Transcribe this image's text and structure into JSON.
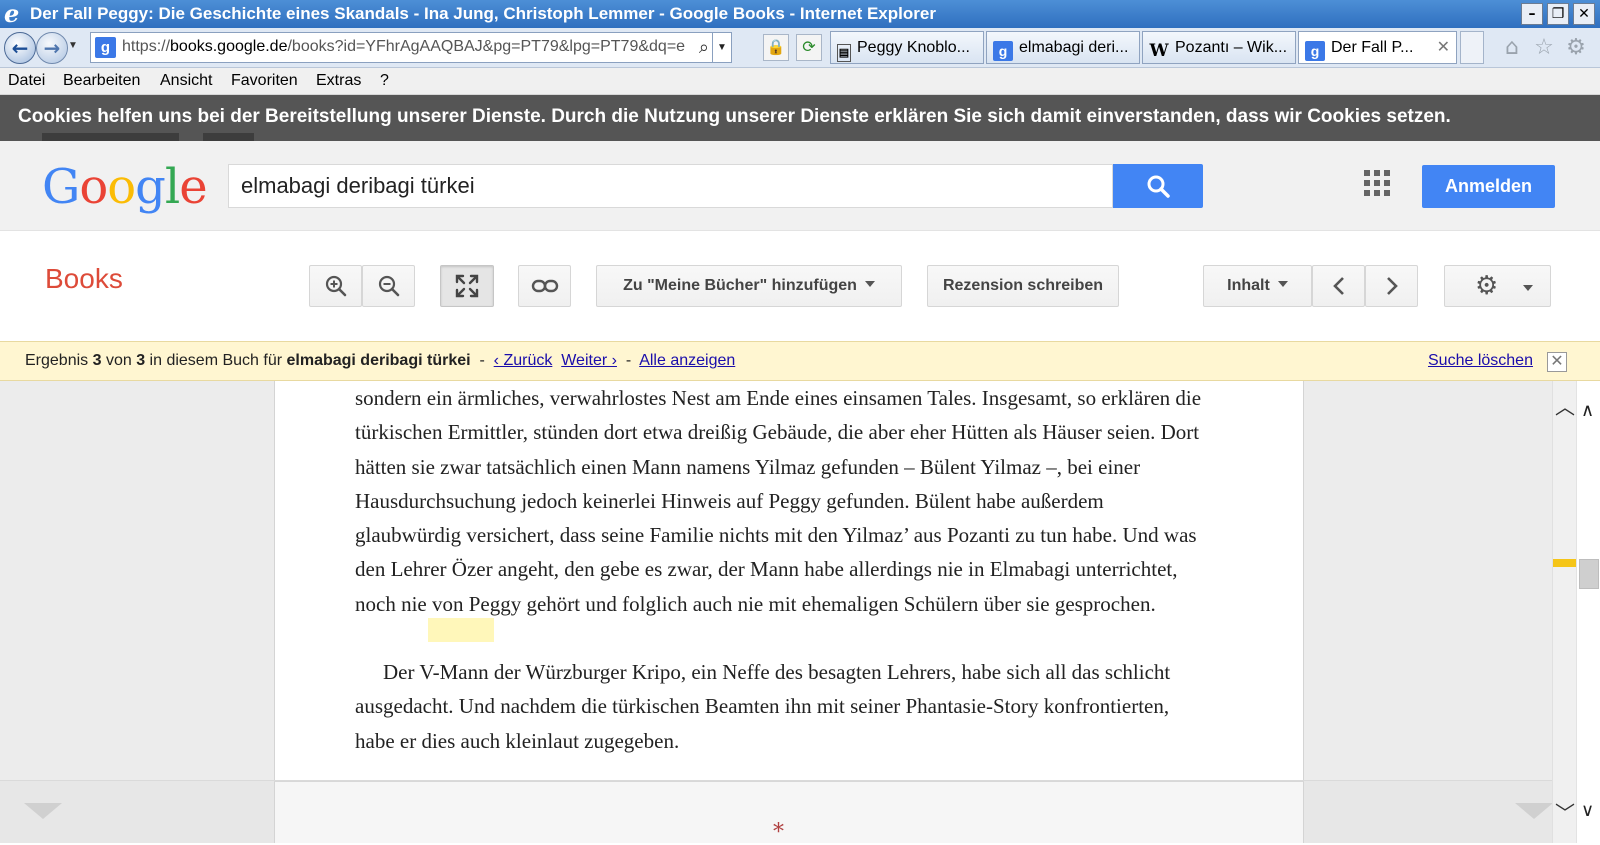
{
  "window": {
    "title": "Der Fall Peggy: Die Geschichte eines Skandals - Ina Jung, Christoph Lemmer - Google Books - Internet Explorer",
    "minimize": "–",
    "restore": "❐",
    "close": "✕"
  },
  "address_bar": {
    "url_prefix": "https://",
    "url_host": "books.google.de",
    "url_rest": "/books?id=YFhrAgAAQBAJ&pg=PT79&lpg=PT79&dq=e"
  },
  "tabs": [
    {
      "label": "Peggy Knoblo...",
      "icon": "document-icon",
      "active": false
    },
    {
      "label": "elmabagi deri...",
      "icon": "google-icon",
      "active": false
    },
    {
      "label": "Pozantı – Wik...",
      "icon": "wikipedia-icon",
      "active": false
    },
    {
      "label": "Der Fall P...",
      "icon": "google-icon",
      "active": true
    }
  ],
  "menu": [
    "Datei",
    "Bearbeiten",
    "Ansicht",
    "Favoriten",
    "Extras",
    "?"
  ],
  "cookie_banner": {
    "text": "Cookies helfen uns bei der Bereitstellung unserer Dienste. Durch die Nutzung unserer Dienste erklären Sie sich damit einverstanden, dass wir Cookies setzen."
  },
  "google_header": {
    "logo": [
      "G",
      "o",
      "o",
      "g",
      "l",
      "e"
    ],
    "search_value": "elmabagi deribagi türkei",
    "signin_label": "Anmelden"
  },
  "books_toolbar": {
    "brand": "Books",
    "add_to_library": "Zu \"Meine Bücher\" hinzufügen",
    "write_review": "Rezension schreiben",
    "contents": "Inhalt"
  },
  "result_bar": {
    "prefix": "Ergebnis ",
    "current": "3",
    "of": " von ",
    "total": "3",
    "middle": " in diesem Buch für ",
    "query": "elmabagi deribagi türkei",
    "sep1": "  -  ",
    "back": "‹ Zurück",
    "next": "Weiter ›",
    "sep2": "  -  ",
    "show_all": "Alle anzeigen",
    "clear": "Suche löschen"
  },
  "book_text": {
    "p1": "sondern ein ärmliches, verwahrlostes Nest am Ende eines einsamen Tales. Insgesamt, so erklären die türkischen Ermittler, stünden dort etwa dreißig Gebäude, die aber eher Hütten als Häuser seien. Dort hätten sie zwar tatsächlich einen Mann namens Yilmaz gefunden – Bülent Yilmaz –, bei einer Hausdurchsuchung jedoch keinerlei Hinweis auf Peggy gefunden. Bülent habe außerdem glaubwürdig versichert, dass seine Familie nichts mit den Yilmaz’ aus Pozanti zu tun habe. Und was den Lehrer Özer angeht, den gebe es zwar, der Mann habe allerdings nie in Elmabagi unterrichtet, noch nie von Peggy gehört und folglich auch nie mit ehemaligen Schülern über sie gesprochen.",
    "p2": "Der V-Mann der Würzburger Kripo, ein Neffe des besagten Lehrers, habe sich all das schlicht ausgedacht. Und nachdem die türkischen Beamten ihn mit seiner Phantasie-Story konfrontierten, habe er dies auch kleinlaut zugegeben.",
    "next_page_mark": "*"
  },
  "colors": {
    "ie_blue": "#2f6fbf",
    "google_blue": "#4285f4",
    "books_red": "#dd4b39",
    "result_bar_bg": "#fff6d1",
    "link": "#1a0dab",
    "highlight": "#fff082"
  }
}
